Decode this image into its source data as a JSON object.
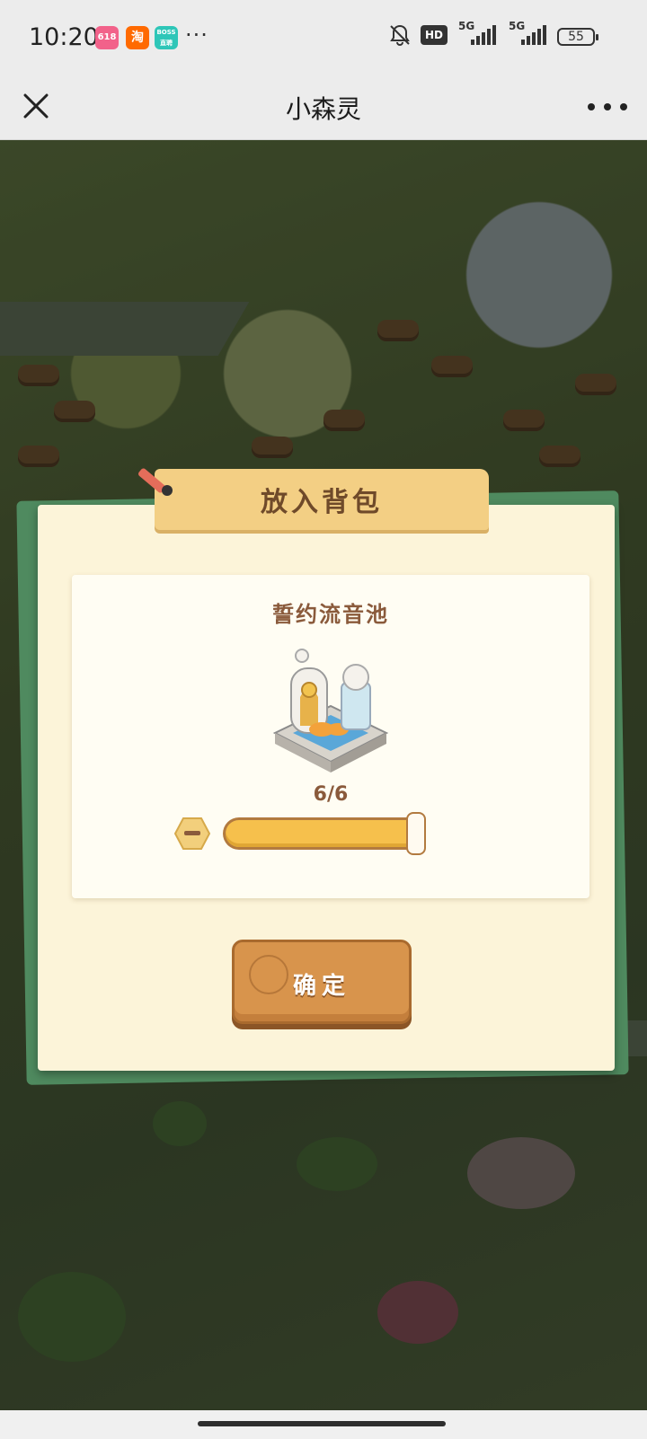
{
  "status_bar": {
    "time": "10:20",
    "app_badges": [
      {
        "name": "618-app-icon",
        "text": "618",
        "color": "#f2628a"
      },
      {
        "name": "taobao-icon",
        "text": "淘",
        "color": "#ff6a00"
      },
      {
        "name": "boss-zhipin-icon",
        "text": "BOSS直聘",
        "color": "#2ec6b8"
      }
    ],
    "more": "···",
    "hd_label": "HD",
    "signal1_label": "5G",
    "signal2_label": "5G",
    "battery": "55"
  },
  "title_bar": {
    "title": "小森灵"
  },
  "dialog": {
    "header": "放入背包",
    "item_name": "誓约流音池",
    "quantity": "6/6",
    "quantity_fraction": 1.0,
    "confirm_label": "确定"
  },
  "colors": {
    "dialog_bg": "#fcf4d9",
    "banner": "#f3cf84",
    "confirm": "#d8944c",
    "slider_fill": "#f6c04c",
    "text_brown": "#8a5a3b"
  }
}
